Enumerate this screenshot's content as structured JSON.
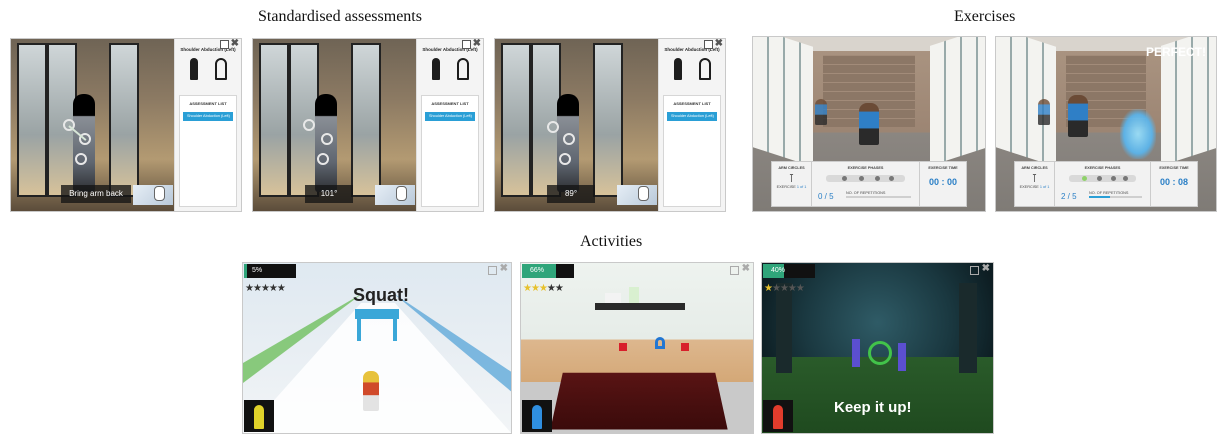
{
  "sections": {
    "assessments_title": "Standardised assessments",
    "exercises_title": "Exercises",
    "activities_title": "Activities"
  },
  "assessments": {
    "panel_title": "Shoulder Abduction (Left)",
    "list_header": "ASSESSMENT LIST",
    "list_item": "Shoulder Abduction (Left)",
    "captions": [
      "Bring arm back",
      "101°",
      "89°"
    ]
  },
  "exercises": {
    "exercise_name": "ARM CIRCLES",
    "phases_label": "EXERCISE PHASES",
    "time_label": "EXERCISE TIME",
    "reps_label": "NO. OF REPETITIONS",
    "exercise_count_label": "EXERCISE",
    "exercise_count": "1 of 1",
    "panels": [
      {
        "reps": "0 / 5",
        "time": "00 : 00",
        "reps_progress": 0.0
      },
      {
        "reps": "2 / 5",
        "time": "00 : 08",
        "reps_progress": 0.4
      }
    ],
    "perfect_text": "PERFECT!"
  },
  "activities": {
    "panels": [
      {
        "percent": "5%",
        "progress": 0.05,
        "stars_filled": 0,
        "banner": "Squat!"
      },
      {
        "percent": "66%",
        "progress": 0.66,
        "stars_filled": 3
      },
      {
        "percent": "40%",
        "progress": 0.4,
        "stars_filled": 1,
        "message": "Keep it up!"
      }
    ]
  },
  "colors": {
    "accent_blue": "#2a9fd6",
    "progress_green": "#2fa57a",
    "star_gold": "#e7c12c"
  }
}
